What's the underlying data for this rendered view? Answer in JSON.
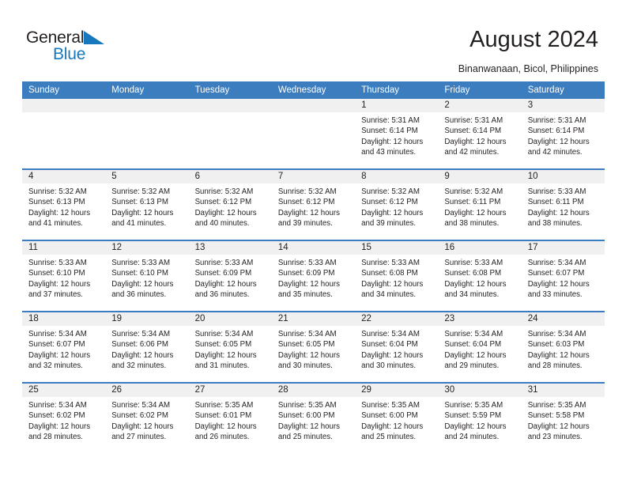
{
  "brand": {
    "name_part1": "General",
    "name_part2": "Blue",
    "accent_color": "#1878be",
    "triangle_icon": "brand-triangle-icon"
  },
  "header": {
    "title": "August 2024",
    "location": "Binanwanaan, Bicol, Philippines"
  },
  "calendar": {
    "header_bg": "#3b7dbf",
    "daynum_bg": "#f0f0f0",
    "weekday_headers": [
      "Sunday",
      "Monday",
      "Tuesday",
      "Wednesday",
      "Thursday",
      "Friday",
      "Saturday"
    ],
    "weeks": [
      [
        {
          "day": "",
          "sunrise": "",
          "sunset": "",
          "daylight1": "",
          "daylight2": ""
        },
        {
          "day": "",
          "sunrise": "",
          "sunset": "",
          "daylight1": "",
          "daylight2": ""
        },
        {
          "day": "",
          "sunrise": "",
          "sunset": "",
          "daylight1": "",
          "daylight2": ""
        },
        {
          "day": "",
          "sunrise": "",
          "sunset": "",
          "daylight1": "",
          "daylight2": ""
        },
        {
          "day": "1",
          "sunrise": "Sunrise: 5:31 AM",
          "sunset": "Sunset: 6:14 PM",
          "daylight1": "Daylight: 12 hours",
          "daylight2": "and 43 minutes."
        },
        {
          "day": "2",
          "sunrise": "Sunrise: 5:31 AM",
          "sunset": "Sunset: 6:14 PM",
          "daylight1": "Daylight: 12 hours",
          "daylight2": "and 42 minutes."
        },
        {
          "day": "3",
          "sunrise": "Sunrise: 5:31 AM",
          "sunset": "Sunset: 6:14 PM",
          "daylight1": "Daylight: 12 hours",
          "daylight2": "and 42 minutes."
        }
      ],
      [
        {
          "day": "4",
          "sunrise": "Sunrise: 5:32 AM",
          "sunset": "Sunset: 6:13 PM",
          "daylight1": "Daylight: 12 hours",
          "daylight2": "and 41 minutes."
        },
        {
          "day": "5",
          "sunrise": "Sunrise: 5:32 AM",
          "sunset": "Sunset: 6:13 PM",
          "daylight1": "Daylight: 12 hours",
          "daylight2": "and 41 minutes."
        },
        {
          "day": "6",
          "sunrise": "Sunrise: 5:32 AM",
          "sunset": "Sunset: 6:12 PM",
          "daylight1": "Daylight: 12 hours",
          "daylight2": "and 40 minutes."
        },
        {
          "day": "7",
          "sunrise": "Sunrise: 5:32 AM",
          "sunset": "Sunset: 6:12 PM",
          "daylight1": "Daylight: 12 hours",
          "daylight2": "and 39 minutes."
        },
        {
          "day": "8",
          "sunrise": "Sunrise: 5:32 AM",
          "sunset": "Sunset: 6:12 PM",
          "daylight1": "Daylight: 12 hours",
          "daylight2": "and 39 minutes."
        },
        {
          "day": "9",
          "sunrise": "Sunrise: 5:32 AM",
          "sunset": "Sunset: 6:11 PM",
          "daylight1": "Daylight: 12 hours",
          "daylight2": "and 38 minutes."
        },
        {
          "day": "10",
          "sunrise": "Sunrise: 5:33 AM",
          "sunset": "Sunset: 6:11 PM",
          "daylight1": "Daylight: 12 hours",
          "daylight2": "and 38 minutes."
        }
      ],
      [
        {
          "day": "11",
          "sunrise": "Sunrise: 5:33 AM",
          "sunset": "Sunset: 6:10 PM",
          "daylight1": "Daylight: 12 hours",
          "daylight2": "and 37 minutes."
        },
        {
          "day": "12",
          "sunrise": "Sunrise: 5:33 AM",
          "sunset": "Sunset: 6:10 PM",
          "daylight1": "Daylight: 12 hours",
          "daylight2": "and 36 minutes."
        },
        {
          "day": "13",
          "sunrise": "Sunrise: 5:33 AM",
          "sunset": "Sunset: 6:09 PM",
          "daylight1": "Daylight: 12 hours",
          "daylight2": "and 36 minutes."
        },
        {
          "day": "14",
          "sunrise": "Sunrise: 5:33 AM",
          "sunset": "Sunset: 6:09 PM",
          "daylight1": "Daylight: 12 hours",
          "daylight2": "and 35 minutes."
        },
        {
          "day": "15",
          "sunrise": "Sunrise: 5:33 AM",
          "sunset": "Sunset: 6:08 PM",
          "daylight1": "Daylight: 12 hours",
          "daylight2": "and 34 minutes."
        },
        {
          "day": "16",
          "sunrise": "Sunrise: 5:33 AM",
          "sunset": "Sunset: 6:08 PM",
          "daylight1": "Daylight: 12 hours",
          "daylight2": "and 34 minutes."
        },
        {
          "day": "17",
          "sunrise": "Sunrise: 5:34 AM",
          "sunset": "Sunset: 6:07 PM",
          "daylight1": "Daylight: 12 hours",
          "daylight2": "and 33 minutes."
        }
      ],
      [
        {
          "day": "18",
          "sunrise": "Sunrise: 5:34 AM",
          "sunset": "Sunset: 6:07 PM",
          "daylight1": "Daylight: 12 hours",
          "daylight2": "and 32 minutes."
        },
        {
          "day": "19",
          "sunrise": "Sunrise: 5:34 AM",
          "sunset": "Sunset: 6:06 PM",
          "daylight1": "Daylight: 12 hours",
          "daylight2": "and 32 minutes."
        },
        {
          "day": "20",
          "sunrise": "Sunrise: 5:34 AM",
          "sunset": "Sunset: 6:05 PM",
          "daylight1": "Daylight: 12 hours",
          "daylight2": "and 31 minutes."
        },
        {
          "day": "21",
          "sunrise": "Sunrise: 5:34 AM",
          "sunset": "Sunset: 6:05 PM",
          "daylight1": "Daylight: 12 hours",
          "daylight2": "and 30 minutes."
        },
        {
          "day": "22",
          "sunrise": "Sunrise: 5:34 AM",
          "sunset": "Sunset: 6:04 PM",
          "daylight1": "Daylight: 12 hours",
          "daylight2": "and 30 minutes."
        },
        {
          "day": "23",
          "sunrise": "Sunrise: 5:34 AM",
          "sunset": "Sunset: 6:04 PM",
          "daylight1": "Daylight: 12 hours",
          "daylight2": "and 29 minutes."
        },
        {
          "day": "24",
          "sunrise": "Sunrise: 5:34 AM",
          "sunset": "Sunset: 6:03 PM",
          "daylight1": "Daylight: 12 hours",
          "daylight2": "and 28 minutes."
        }
      ],
      [
        {
          "day": "25",
          "sunrise": "Sunrise: 5:34 AM",
          "sunset": "Sunset: 6:02 PM",
          "daylight1": "Daylight: 12 hours",
          "daylight2": "and 28 minutes."
        },
        {
          "day": "26",
          "sunrise": "Sunrise: 5:34 AM",
          "sunset": "Sunset: 6:02 PM",
          "daylight1": "Daylight: 12 hours",
          "daylight2": "and 27 minutes."
        },
        {
          "day": "27",
          "sunrise": "Sunrise: 5:35 AM",
          "sunset": "Sunset: 6:01 PM",
          "daylight1": "Daylight: 12 hours",
          "daylight2": "and 26 minutes."
        },
        {
          "day": "28",
          "sunrise": "Sunrise: 5:35 AM",
          "sunset": "Sunset: 6:00 PM",
          "daylight1": "Daylight: 12 hours",
          "daylight2": "and 25 minutes."
        },
        {
          "day": "29",
          "sunrise": "Sunrise: 5:35 AM",
          "sunset": "Sunset: 6:00 PM",
          "daylight1": "Daylight: 12 hours",
          "daylight2": "and 25 minutes."
        },
        {
          "day": "30",
          "sunrise": "Sunrise: 5:35 AM",
          "sunset": "Sunset: 5:59 PM",
          "daylight1": "Daylight: 12 hours",
          "daylight2": "and 24 minutes."
        },
        {
          "day": "31",
          "sunrise": "Sunrise: 5:35 AM",
          "sunset": "Sunset: 5:58 PM",
          "daylight1": "Daylight: 12 hours",
          "daylight2": "and 23 minutes."
        }
      ]
    ]
  }
}
